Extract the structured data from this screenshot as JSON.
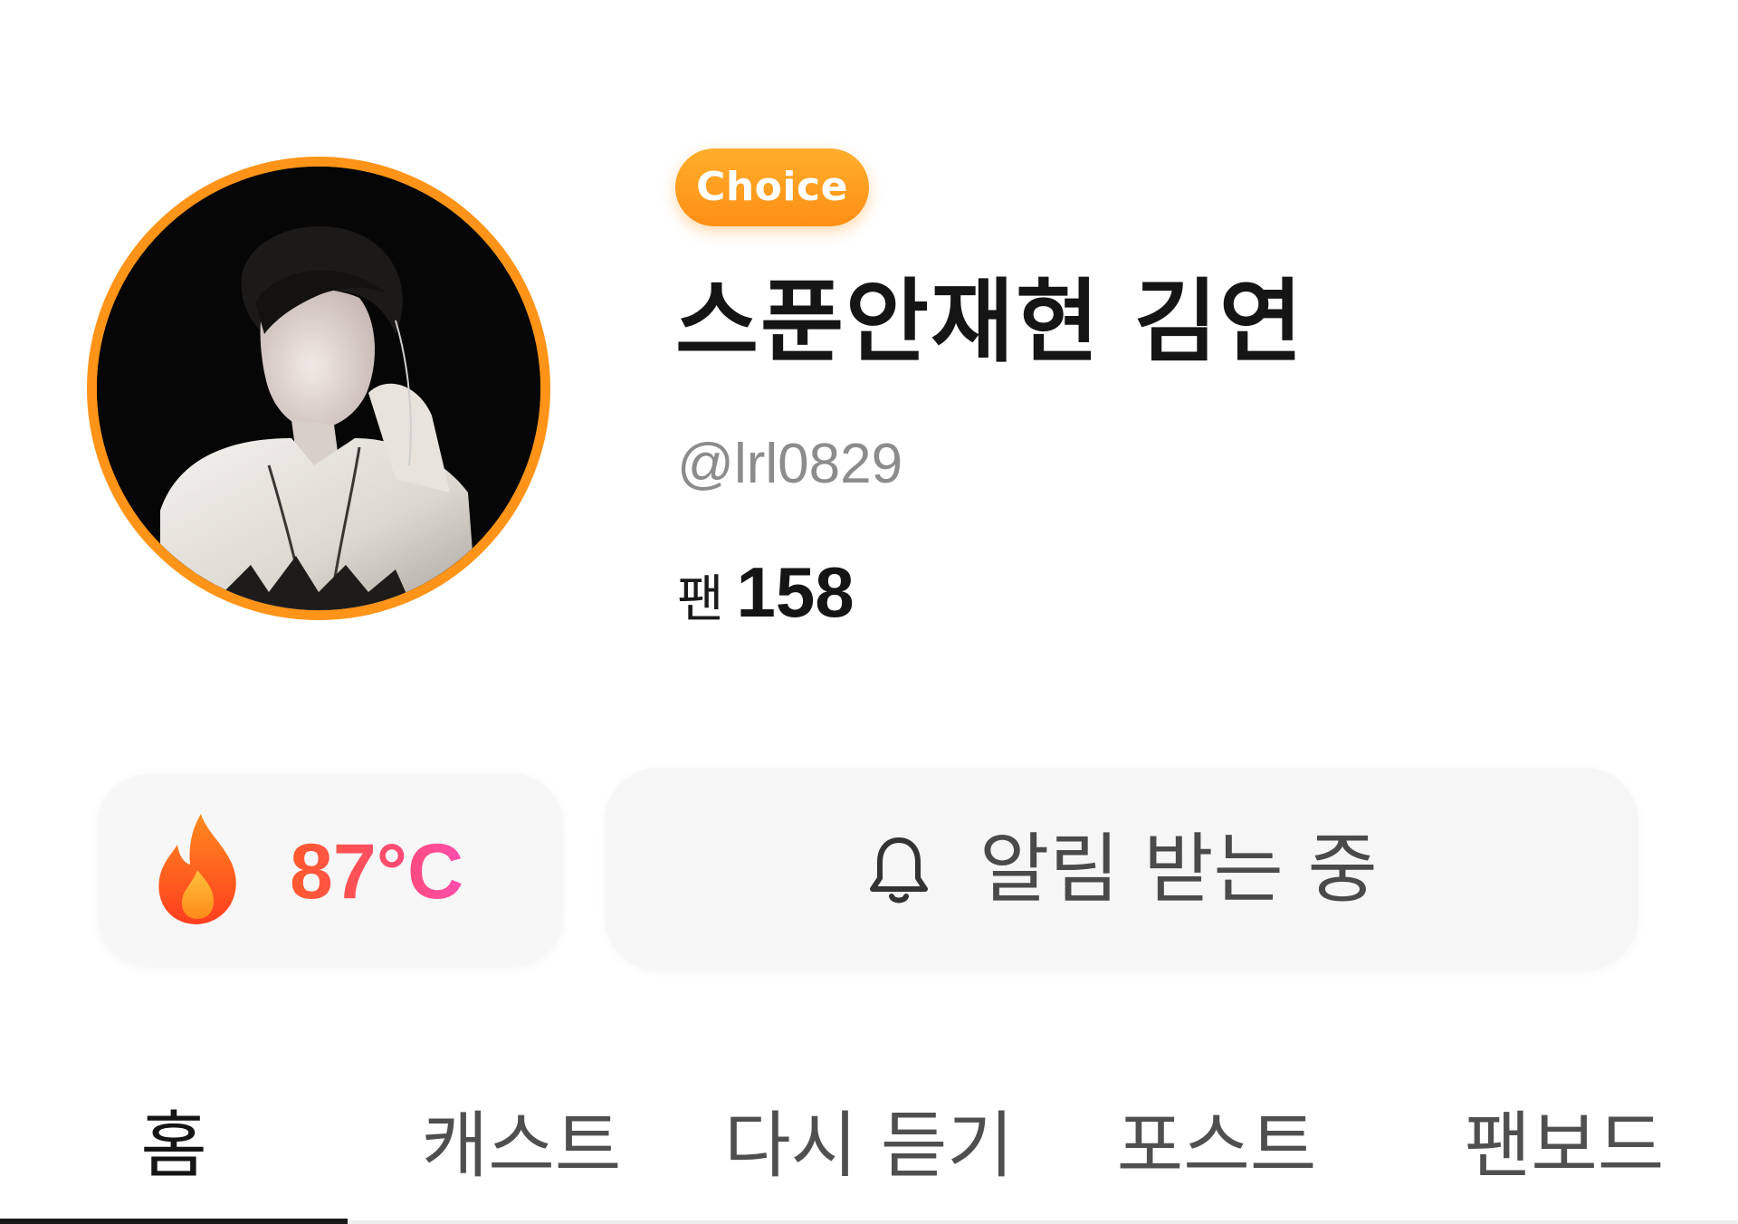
{
  "profile": {
    "badge": "Choice",
    "name": "스푼안재현 김연",
    "handle": "@lrl0829",
    "fans_label": "팬",
    "fans_count": "158",
    "avatar_icon": "profile-photo",
    "accent_color": "#ff9418"
  },
  "stats": {
    "temperature": "87°C",
    "temperature_icon": "flame-icon",
    "notify_label": "알림 받는 중",
    "notify_icon": "bell-icon"
  },
  "tabs": [
    {
      "label": "홈",
      "active": true
    },
    {
      "label": "캐스트",
      "active": false
    },
    {
      "label": "다시 듣기",
      "active": false
    },
    {
      "label": "포스트",
      "active": false
    },
    {
      "label": "팬보드",
      "active": false
    }
  ]
}
